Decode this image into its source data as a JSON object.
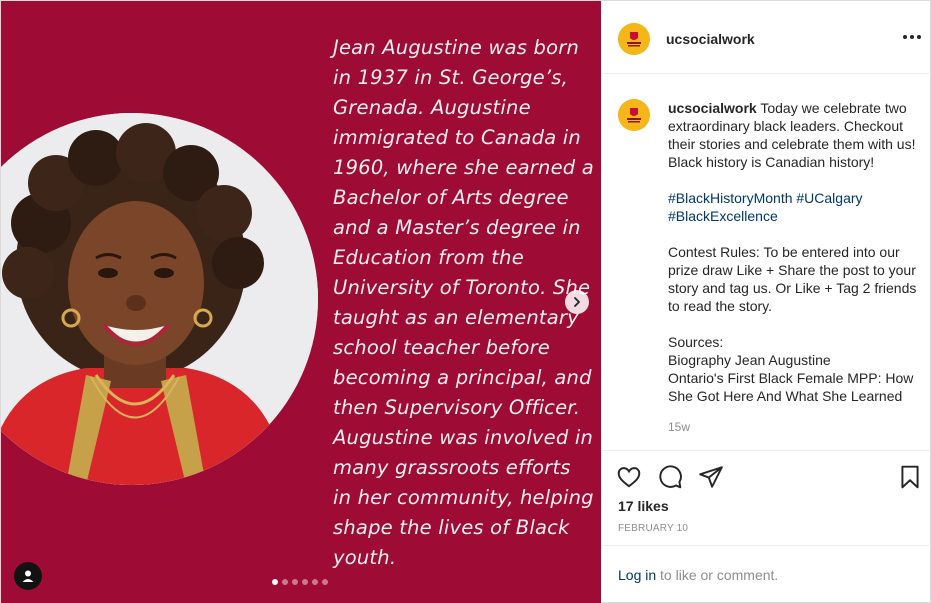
{
  "post": {
    "username": "ucsocialwork",
    "avatar_icon": "university-of-calgary-logo",
    "brand_color": "#9e0b35",
    "bio_text": "Jean Augustine was born in 1937 in St. George’s, Grenada. Augustine immigrated to Canada in 1960, where she earned a Bachelor of Arts degree and a Master’s degree in Education from the University of Toronto. She taught as an elementary school teacher before becoming a principal, and then Supervisory Officer. Augustine was involved in many grassroots efforts in her community, helping shape the lives of Black youth.",
    "carousel_count": 6,
    "carousel_active": 1
  },
  "caption": {
    "username": "ucsocialwork",
    "text": " Today we celebrate two extraordinary black leaders. Checkout their stories and celebrate them with us! Black history is Canadian history!",
    "hashtags": [
      "#BlackHistoryMonth",
      "#UCalgary",
      "#BlackExcellence"
    ],
    "contest": "Contest Rules: To be entered into our prize draw Like + Share the post to your story and tag us. Or Like + Tag 2 friends to read the story.",
    "sources_label": "Sources:",
    "source_1": "Biography Jean Augustine",
    "source_2": "Ontario's First Black Female MPP: How She Got Here And What She Learned",
    "time_ago": "15w"
  },
  "actions": {
    "likes": "17 likes",
    "date": "FEBRUARY 10",
    "icons": [
      "heart-icon",
      "comment-icon",
      "share-icon",
      "bookmark-icon"
    ]
  },
  "login": {
    "link": "Log in",
    "rest": " to like or comment."
  }
}
